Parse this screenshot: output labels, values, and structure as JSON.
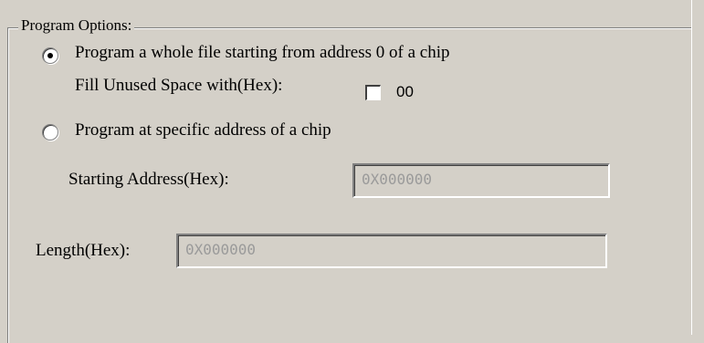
{
  "program_options": {
    "group_title": "Program Options:",
    "whole_file_option": {
      "label": "Program a whole file starting from address 0 of a chip",
      "selected": true
    },
    "fill_unused": {
      "label": "Fill Unused Space with(Hex):",
      "checked": false,
      "value": "00"
    },
    "specific_address_option": {
      "label": "Program at specific address of a chip",
      "selected": false
    },
    "starting_address": {
      "label": "Starting Address(Hex):",
      "value": "0X000000",
      "enabled": false
    },
    "length": {
      "label": "Length(Hex):",
      "value": "0X000000",
      "enabled": false
    }
  },
  "colors": {
    "background": "#d4d0c8",
    "disabled_text": "#9a9a9a",
    "text": "#000000"
  }
}
